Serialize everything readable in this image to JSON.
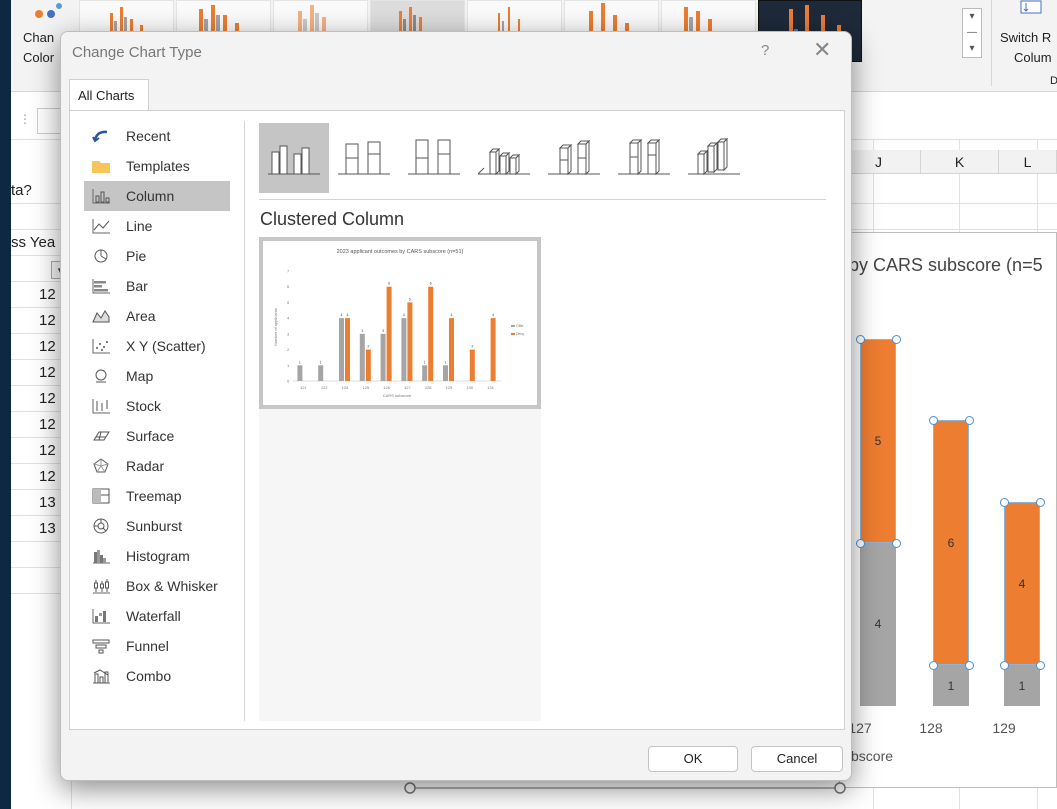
{
  "ribbon": {
    "change_colors_label_1": "Chan",
    "change_colors_label_2": "Color",
    "switch_label_1": "Switch R",
    "switch_label_2": "Colum",
    "data_group_label": "D"
  },
  "sheet": {
    "left_cells": [
      "ta?",
      "ss Yea"
    ],
    "left_numbers": [
      "12",
      "12",
      "12",
      "12",
      "12",
      "12",
      "12",
      "12",
      "13",
      "13"
    ],
    "column_headers": [
      "J",
      "K",
      "L"
    ]
  },
  "chart_data": {
    "type": "bar",
    "title": "by CARS subscore (n=5",
    "xlabel": "bscore",
    "categories": [
      "127",
      "128",
      "129"
    ],
    "series": [
      {
        "color": "#a5a5a5",
        "values": [
          4,
          1,
          1
        ]
      },
      {
        "color": "#ed7d31",
        "values": [
          5,
          6,
          4
        ]
      }
    ]
  },
  "dialog": {
    "title": "Change Chart Type",
    "help": "?",
    "close": "✕",
    "tab_all_charts": "All Charts",
    "categories": [
      {
        "label": "Recent",
        "icon": "recent-icon"
      },
      {
        "label": "Templates",
        "icon": "folder-icon"
      },
      {
        "label": "Column",
        "icon": "column-chart-icon"
      },
      {
        "label": "Line",
        "icon": "line-chart-icon"
      },
      {
        "label": "Pie",
        "icon": "pie-chart-icon"
      },
      {
        "label": "Bar",
        "icon": "bar-chart-icon"
      },
      {
        "label": "Area",
        "icon": "area-chart-icon"
      },
      {
        "label": "X Y (Scatter)",
        "icon": "scatter-chart-icon"
      },
      {
        "label": "Map",
        "icon": "map-chart-icon"
      },
      {
        "label": "Stock",
        "icon": "stock-chart-icon"
      },
      {
        "label": "Surface",
        "icon": "surface-chart-icon"
      },
      {
        "label": "Radar",
        "icon": "radar-chart-icon"
      },
      {
        "label": "Treemap",
        "icon": "treemap-chart-icon"
      },
      {
        "label": "Sunburst",
        "icon": "sunburst-chart-icon"
      },
      {
        "label": "Histogram",
        "icon": "histogram-chart-icon"
      },
      {
        "label": "Box & Whisker",
        "icon": "box-whisker-chart-icon"
      },
      {
        "label": "Waterfall",
        "icon": "waterfall-chart-icon"
      },
      {
        "label": "Funnel",
        "icon": "funnel-chart-icon"
      },
      {
        "label": "Combo",
        "icon": "combo-chart-icon"
      }
    ],
    "selected_category": "Column",
    "subtypes": [
      "clustered-column",
      "stacked-column",
      "100-stacked-column",
      "3d-clustered-column",
      "3d-stacked-column",
      "3d-100-stacked-column",
      "3d-column"
    ],
    "subtype_title": "Clustered Column",
    "preview": {
      "title": "2023 applicant outcomes by CARS subscore (n=51)",
      "xlabel": "CARS subscore",
      "ylabel": "Number of applicants",
      "categories": [
        "121",
        "122",
        "124",
        "125",
        "126",
        "127",
        "128",
        "129",
        "130",
        "131"
      ],
      "series": [
        {
          "name": "Offer",
          "color": "#a5a5a5",
          "values": [
            1,
            1,
            4,
            3,
            3,
            4,
            1,
            1,
            0,
            0
          ]
        },
        {
          "name": "Deny",
          "color": "#ed7d31",
          "values": [
            0,
            0,
            4,
            2,
            6,
            5,
            6,
            4,
            2,
            4
          ]
        }
      ],
      "ylim": [
        0,
        7
      ]
    },
    "ok_label": "OK",
    "cancel_label": "Cancel"
  }
}
